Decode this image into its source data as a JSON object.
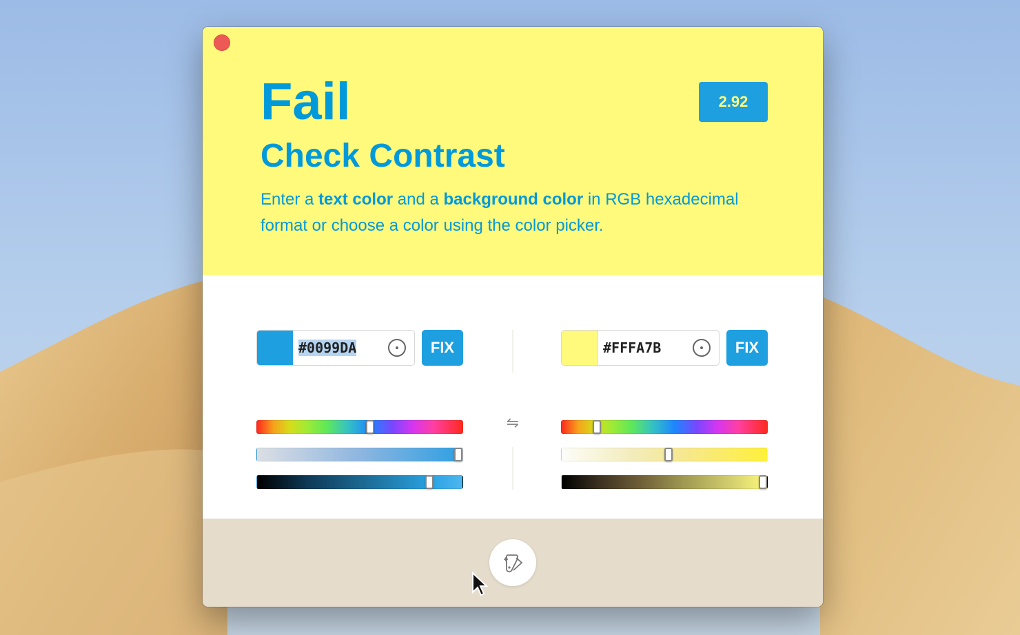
{
  "window": {
    "status": "Fail",
    "ratio": "2.92",
    "title": "Check Contrast",
    "description": {
      "p1": "Enter a ",
      "b1": "text color",
      "p2": " and a ",
      "b2": "background color",
      "p3": " in RGB hexadecimal format or choose a color using the color picker."
    }
  },
  "text_color": {
    "hex": "#0099DA",
    "swatch": "#1e9fdf",
    "fix_label": "FIX",
    "hue_level": 0.55,
    "saturation_level": 0.98,
    "lightness_level": 0.84
  },
  "background_color": {
    "hex": "#FFFA7B",
    "swatch": "#fffa7b",
    "fix_label": "FIX",
    "hue_level": 0.17,
    "saturation_level": 0.52,
    "lightness_level": 0.98
  },
  "icons": {
    "close": "close-icon",
    "picker": "eyedropper-icon",
    "swap": "swap-icon",
    "palette": "palette-icon"
  },
  "colors": {
    "accent": "#0099da",
    "hero_bg": "#fffa7b",
    "footer_bg": "#e5dccc"
  }
}
